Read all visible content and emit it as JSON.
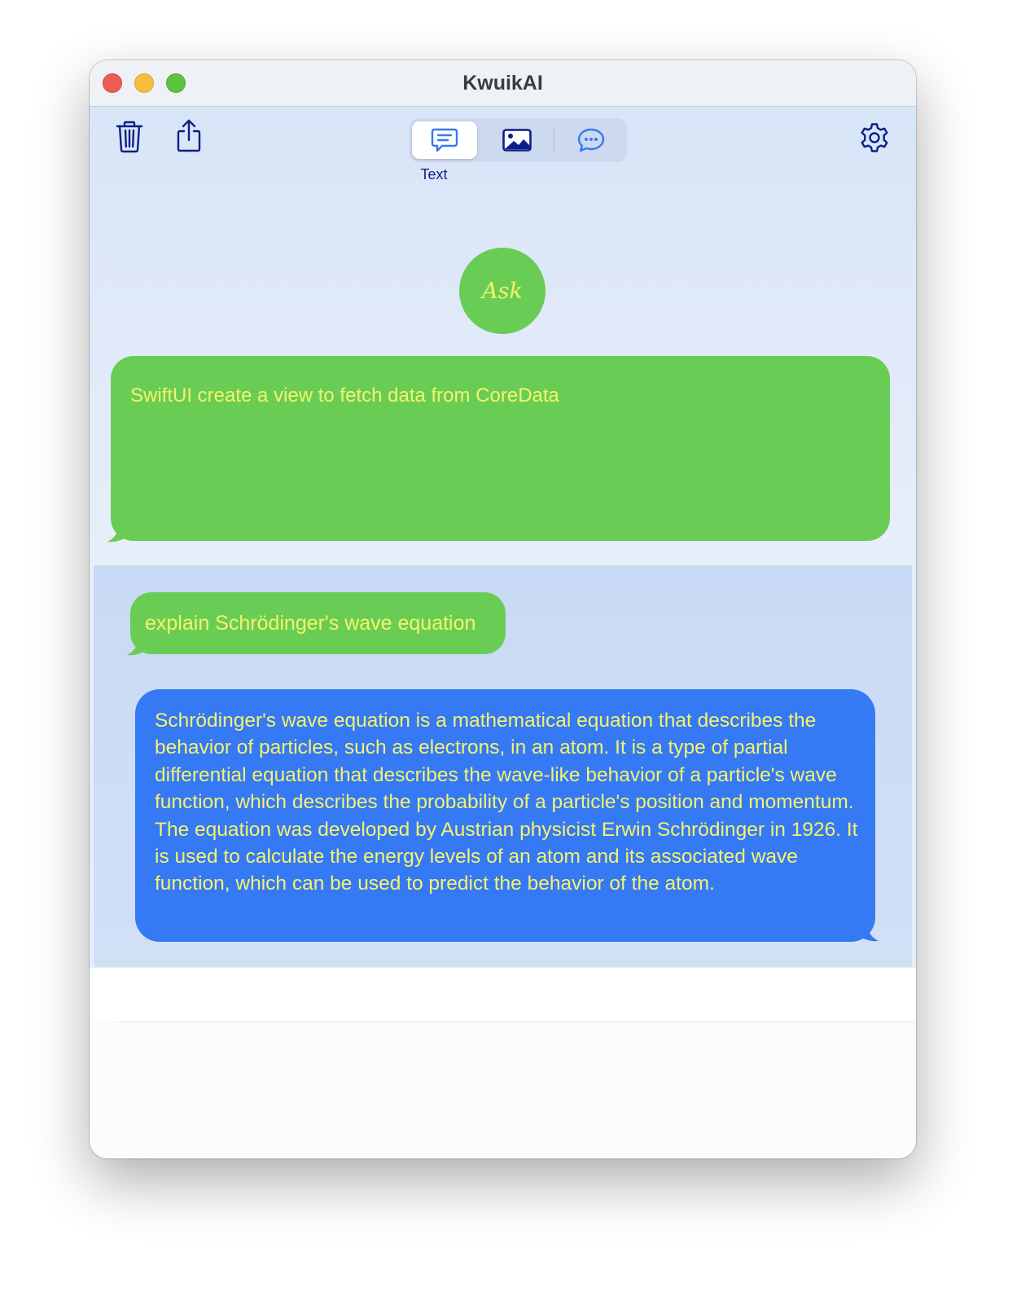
{
  "window": {
    "title": "KwuikAI"
  },
  "toolbar": {
    "left_icons": [
      "trash-icon",
      "share-icon"
    ],
    "right_icons": [
      "gear-icon"
    ],
    "mode_segments": [
      {
        "icon": "text-bubble-icon",
        "selected": true
      },
      {
        "icon": "image-icon",
        "selected": false
      },
      {
        "icon": "chat-bubble-icon",
        "selected": false
      }
    ],
    "selected_mode_label": "Text"
  },
  "ask": {
    "button_label": "Ask"
  },
  "prompt": {
    "text": "SwiftUI create a view to fetch data from CoreData"
  },
  "history": {
    "question": "explain Schrödinger's wave equation",
    "answer": "Schrödinger's wave equation is a mathematical equation that describes the behavior of particles, such as electrons, in an atom. It is a type of partial differential equation that describes the wave-like behavior of a particle's wave function, which describes the probability of a particle's position and momentum. The equation was developed by Austrian physicist Erwin Schrödinger in 1926. It is used to calculate the energy levels of an atom and its associated wave function, which can be used to predict the behavior of the atom."
  },
  "colors": {
    "accent_green": "#69cd55",
    "answer_blue": "#3679f4",
    "bubble_text_yellow": "#f5f36c",
    "icon_navy": "#0c1f86"
  }
}
